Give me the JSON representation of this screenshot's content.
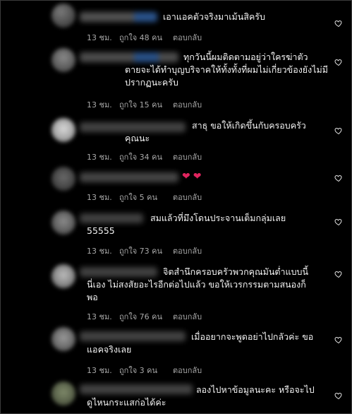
{
  "comments": [
    {
      "text": "เอาแอคตัวจริงมาเม้นสิครับ",
      "time": "13 ชม.",
      "likes": "ถูกใจ 48 คน",
      "reply": "ตอบกลับ"
    },
    {
      "text": "ทุกวันนี้ผมติดตามอยู่ว่าใครฆ่าตัว\nตายจะได้ทำบุญบริจาคให้ทั้งทั้งที่ผมไม่เกี่ยวข้องยังไม่มี\nปรากฏนะครับ",
      "time": "13 ชม.",
      "likes": "ถูกใจ 15 คน",
      "reply": "ตอบกลับ"
    },
    {
      "text": "สาธุ ขอให้เกิดขึ้นกับครอบครัว\nคุณนะ",
      "time": "13 ชม.",
      "likes": "ถูกใจ 34 คน",
      "reply": "ตอบกลับ"
    },
    {
      "text": "",
      "emoji": [
        "❤",
        "❤"
      ],
      "time": "13 ชม.",
      "likes": "ถูกใจ 5 คน",
      "reply": "ตอบกลับ"
    },
    {
      "text": "สมแล้วที่มึงโดนประจานเต็มกลุ่มเลย\n55555",
      "time": "13 ชม.",
      "likes": "ถูกใจ 73 คน",
      "reply": "ตอบกลับ"
    },
    {
      "text": "จิตสำนึกครอบครัวพวกคุณมันต่ำแบบนี้\nนี่เอง ไม่สงสัยอะไรอีกต่อไปแล้ว ขอให้เวรกรรมตามสนองก็\nพอ",
      "time": "13 ชม.",
      "likes": "ถูกใจ 76 คน",
      "reply": "ตอบกลับ"
    },
    {
      "text": "เมื่ออยากจะพูดอย่าไปกลัวค่ะ ขอ\nแอคจริงเลย",
      "time": "13 ชม.",
      "likes": "ถูกใจ 3 คน",
      "reply": "ตอบกลับ"
    },
    {
      "text": "ลองไปหาข้อมูลนะคะ หรือจะไป\nดูไหนกระแสก่อได้ค่ะ",
      "time": "",
      "likes": "",
      "reply": ""
    }
  ],
  "colors": {
    "background": "#000000",
    "text": "#f2f2f2",
    "meta": "#a8a8a8",
    "emoji_heart": "#e0245e"
  },
  "icons": {
    "like": "heart-outline-icon"
  }
}
